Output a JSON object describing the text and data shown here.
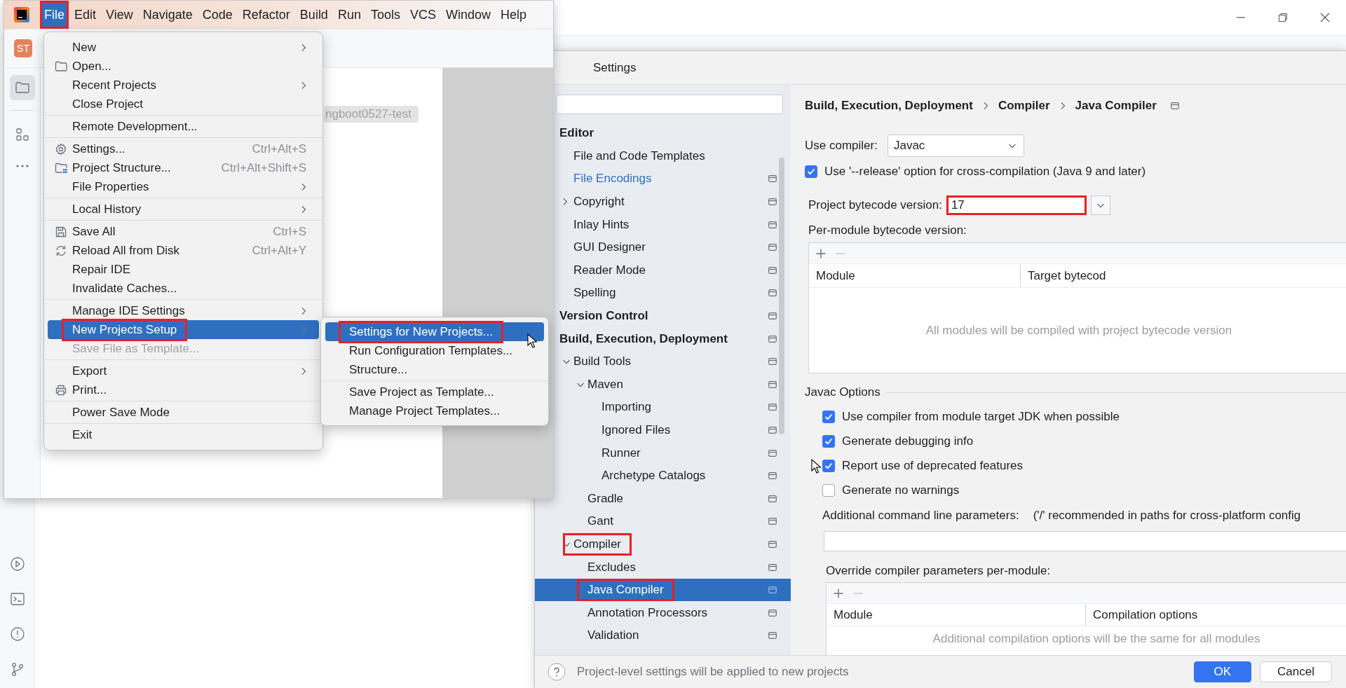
{
  "ide_window": {
    "menu_bar": [
      {
        "label": "File",
        "selected": true,
        "highlighted": true
      },
      {
        "label": "Edit",
        "selected": false,
        "highlighted": false
      },
      {
        "label": "View",
        "selected": false,
        "highlighted": false
      },
      {
        "label": "Navigate",
        "selected": false,
        "highlighted": false
      },
      {
        "label": "Code",
        "selected": false,
        "highlighted": false
      },
      {
        "label": "Refactor",
        "selected": false,
        "highlighted": false
      },
      {
        "label": "Build",
        "selected": false,
        "highlighted": false
      },
      {
        "label": "Run",
        "selected": false,
        "highlighted": false
      },
      {
        "label": "Tools",
        "selected": false,
        "highlighted": false
      },
      {
        "label": "VCS",
        "selected": false,
        "highlighted": false
      },
      {
        "label": "Window",
        "selected": false,
        "highlighted": false
      },
      {
        "label": "Help",
        "selected": false,
        "highlighted": false
      }
    ],
    "project_badge": "ST",
    "editor_tab": "ngboot0527-test"
  },
  "file_menu": {
    "groups": [
      [
        {
          "label": "New",
          "submenu": true,
          "disabled": false,
          "selected": false,
          "highlighted": false
        },
        {
          "label": "Open...",
          "submenu": false,
          "disabled": false,
          "selected": false,
          "highlighted": false
        },
        {
          "label": "Recent Projects",
          "submenu": true,
          "disabled": false,
          "selected": false,
          "highlighted": false
        },
        {
          "label": "Close Project",
          "submenu": false,
          "disabled": false,
          "selected": false,
          "highlighted": false
        }
      ],
      [
        {
          "label": "Remote Development...",
          "submenu": false,
          "disabled": false,
          "selected": false,
          "highlighted": false
        }
      ],
      [
        {
          "label": "Settings...",
          "shortcut": "Ctrl+Alt+S",
          "submenu": false,
          "disabled": false,
          "selected": false,
          "highlighted": false
        },
        {
          "label": "Project Structure...",
          "shortcut": "Ctrl+Alt+Shift+S",
          "submenu": false,
          "disabled": false,
          "selected": false,
          "highlighted": false
        },
        {
          "label": "File Properties",
          "submenu": true,
          "disabled": false,
          "selected": false,
          "highlighted": false
        }
      ],
      [
        {
          "label": "Local History",
          "submenu": true,
          "disabled": false,
          "selected": false,
          "highlighted": false
        }
      ],
      [
        {
          "label": "Save All",
          "shortcut": "Ctrl+S",
          "submenu": false,
          "disabled": false,
          "selected": false,
          "highlighted": false
        },
        {
          "label": "Reload All from Disk",
          "shortcut": "Ctrl+Alt+Y",
          "submenu": false,
          "disabled": false,
          "selected": false,
          "highlighted": false
        },
        {
          "label": "Repair IDE",
          "submenu": false,
          "disabled": false,
          "selected": false,
          "highlighted": false
        },
        {
          "label": "Invalidate Caches...",
          "submenu": false,
          "disabled": false,
          "selected": false,
          "highlighted": false
        }
      ],
      [
        {
          "label": "Manage IDE Settings",
          "submenu": true,
          "disabled": false,
          "selected": false,
          "highlighted": false
        },
        {
          "label": "New Projects Setup",
          "submenu": true,
          "disabled": false,
          "selected": true,
          "highlighted": true
        },
        {
          "label": "Save File as Template...",
          "submenu": false,
          "disabled": true,
          "selected": false,
          "highlighted": false
        }
      ],
      [
        {
          "label": "Export",
          "submenu": true,
          "disabled": false,
          "selected": false,
          "highlighted": false
        },
        {
          "label": "Print...",
          "submenu": false,
          "disabled": false,
          "selected": false,
          "highlighted": false
        }
      ],
      [
        {
          "label": "Power Save Mode",
          "submenu": false,
          "disabled": false,
          "selected": false,
          "highlighted": false
        }
      ],
      [
        {
          "label": "Exit",
          "submenu": false,
          "disabled": false,
          "selected": false,
          "highlighted": false
        }
      ]
    ]
  },
  "new_projects_setup_menu": {
    "groups": [
      [
        {
          "label": "Settings for New Projects...",
          "selected": true,
          "highlighted": true
        },
        {
          "label": "Run Configuration Templates...",
          "selected": false,
          "highlighted": false
        },
        {
          "label": "Structure...",
          "selected": false,
          "highlighted": false
        }
      ],
      [
        {
          "label": "Save Project as Template...",
          "selected": false,
          "highlighted": false
        },
        {
          "label": "Manage Project Templates...",
          "selected": false,
          "highlighted": false
        }
      ]
    ]
  },
  "settings_dialog": {
    "title": "Settings",
    "tree": [
      {
        "label": "Editor",
        "kind": "section",
        "project_level": false,
        "modified": false,
        "selected": false,
        "highlighted": false,
        "children": [
          {
            "label": "File and Code Templates",
            "kind": "page",
            "project_level": false,
            "modified": false,
            "selected": false,
            "highlighted": false
          },
          {
            "label": "File Encodings",
            "kind": "page",
            "project_level": true,
            "modified": true,
            "selected": false,
            "highlighted": false
          },
          {
            "label": "Copyright",
            "kind": "page",
            "project_level": true,
            "modified": false,
            "selected": false,
            "highlighted": false,
            "expanded": false
          },
          {
            "label": "Inlay Hints",
            "kind": "page",
            "project_level": true,
            "modified": false,
            "selected": false,
            "highlighted": false
          },
          {
            "label": "GUI Designer",
            "kind": "page",
            "project_level": true,
            "modified": false,
            "selected": false,
            "highlighted": false
          },
          {
            "label": "Reader Mode",
            "kind": "page",
            "project_level": true,
            "modified": false,
            "selected": false,
            "highlighted": false
          },
          {
            "label": "Spelling",
            "kind": "page",
            "project_level": true,
            "modified": false,
            "selected": false,
            "highlighted": false
          }
        ]
      },
      {
        "label": "Version Control",
        "kind": "section",
        "project_level": true,
        "modified": false,
        "selected": false,
        "highlighted": false
      },
      {
        "label": "Build, Execution, Deployment",
        "kind": "section",
        "project_level": true,
        "modified": false,
        "selected": false,
        "highlighted": false,
        "children": [
          {
            "label": "Build Tools",
            "kind": "page",
            "project_level": true,
            "modified": false,
            "selected": false,
            "highlighted": false,
            "expanded": true,
            "children": [
              {
                "label": "Maven",
                "kind": "page",
                "project_level": true,
                "modified": false,
                "selected": false,
                "highlighted": false,
                "expanded": true,
                "children": [
                  {
                    "label": "Importing",
                    "kind": "page",
                    "project_level": true,
                    "modified": false,
                    "selected": false,
                    "highlighted": false
                  },
                  {
                    "label": "Ignored Files",
                    "kind": "page",
                    "project_level": true,
                    "modified": false,
                    "selected": false,
                    "highlighted": false
                  },
                  {
                    "label": "Runner",
                    "kind": "page",
                    "project_level": true,
                    "modified": false,
                    "selected": false,
                    "highlighted": false
                  },
                  {
                    "label": "Archetype Catalogs",
                    "kind": "page",
                    "project_level": true,
                    "modified": false,
                    "selected": false,
                    "highlighted": false
                  }
                ]
              },
              {
                "label": "Gradle",
                "kind": "page",
                "project_level": true,
                "modified": false,
                "selected": false,
                "highlighted": false
              },
              {
                "label": "Gant",
                "kind": "page",
                "project_level": true,
                "modified": false,
                "selected": false,
                "highlighted": false
              }
            ]
          },
          {
            "label": "Compiler",
            "kind": "page",
            "project_level": true,
            "modified": false,
            "selected": false,
            "highlighted": true,
            "expanded": true,
            "children": [
              {
                "label": "Excludes",
                "kind": "page",
                "project_level": true,
                "modified": false,
                "selected": false,
                "highlighted": false
              },
              {
                "label": "Java Compiler",
                "kind": "page",
                "project_level": true,
                "modified": false,
                "selected": true,
                "highlighted": true
              },
              {
                "label": "Annotation Processors",
                "kind": "page",
                "project_level": true,
                "modified": false,
                "selected": false,
                "highlighted": false
              },
              {
                "label": "Validation",
                "kind": "page",
                "project_level": true,
                "modified": false,
                "selected": false,
                "highlighted": false
              }
            ]
          }
        ]
      }
    ],
    "breadcrumb": [
      "Build, Execution, Deployment",
      "Compiler",
      "Java Compiler"
    ],
    "use_compiler": {
      "label": "Use compiler:",
      "value": "Javac"
    },
    "release_option": {
      "label": "Use '--release' option for cross-compilation (Java 9 and later)",
      "checked": true
    },
    "bytecode_version": {
      "label": "Project bytecode version:",
      "value": "17",
      "highlighted": true
    },
    "per_module": {
      "label": "Per-module bytecode version:",
      "columns": [
        "Module",
        "Target bytecod"
      ],
      "empty_text": "All modules will be compiled with project bytecode version"
    },
    "javac_options": {
      "title": "Javac Options",
      "options": [
        {
          "label": "Use compiler from module target JDK when possible",
          "checked": true
        },
        {
          "label": "Generate debugging info",
          "checked": true
        },
        {
          "label": "Report use of deprecated features",
          "checked": true
        },
        {
          "label": "Generate no warnings",
          "checked": false
        }
      ]
    },
    "additional_parameters": {
      "label": "Additional command line parameters:",
      "hint": "('/' recommended in paths for cross-platform config"
    },
    "override_parameters": {
      "label": "Override compiler parameters per-module:",
      "columns": [
        "Module",
        "Compilation options"
      ],
      "empty_text": "Additional compilation options will be the same for all modules"
    },
    "footer": {
      "help_text": "Project-level settings will be applied to new projects",
      "buttons": [
        {
          "label": "OK",
          "kind": "primary"
        },
        {
          "label": "Cancel",
          "kind": "secondary"
        }
      ]
    }
  }
}
